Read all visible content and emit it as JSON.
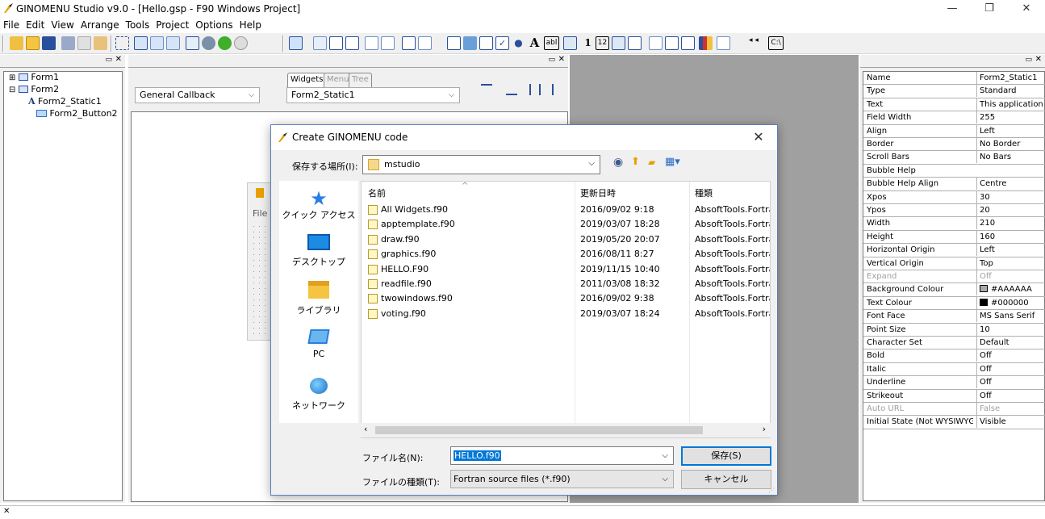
{
  "window": {
    "title": "GINOMENU Studio v9.0 - [Hello.gsp - F90 Windows Project]",
    "minimize": "—",
    "maximize": "❐",
    "close": "✕"
  },
  "menu": [
    "File",
    "Edit",
    "View",
    "Arrange",
    "Tools",
    "Project",
    "Options",
    "Help"
  ],
  "toolbar": {
    "text_tool_glyph": "A",
    "label_tool": "abl",
    "number_tool": "1",
    "int_tool": "12",
    "path_tool": "C:\\"
  },
  "tree": {
    "items": [
      {
        "label": "Form1",
        "expander": "⊞"
      },
      {
        "label": "Form2",
        "expander": "⊟"
      },
      {
        "label": "Form2_Static1",
        "glyph": "A"
      },
      {
        "label": "Form2_Button2"
      }
    ]
  },
  "center": {
    "tabs": [
      "Widgets",
      "Menu",
      "Tree"
    ],
    "callback_combo": "General Callback",
    "widget_combo": "Form2_Static1"
  },
  "form_preview": {
    "menu_label": "File"
  },
  "properties": [
    {
      "name": "Name",
      "value": "Form2_Static1"
    },
    {
      "name": "Type",
      "value": "Standard"
    },
    {
      "name": "Text",
      "value": "This application de"
    },
    {
      "name": "Field Width",
      "value": "255"
    },
    {
      "name": "Align",
      "value": "Left"
    },
    {
      "name": "Border",
      "value": "No Border"
    },
    {
      "name": "Scroll Bars",
      "value": "No Bars"
    },
    {
      "name": "Bubble Help",
      "value": ""
    },
    {
      "name": "Bubble Help Align",
      "value": "Centre"
    },
    {
      "name": "Xpos",
      "value": "30"
    },
    {
      "name": "Ypos",
      "value": "20"
    },
    {
      "name": "Width",
      "value": "210"
    },
    {
      "name": "Height",
      "value": "160"
    },
    {
      "name": "Horizontal Origin",
      "value": "Left"
    },
    {
      "name": "Vertical Origin",
      "value": "Top"
    },
    {
      "name": "Expand",
      "value": "Off",
      "disabled": true
    },
    {
      "name": "Background Colour",
      "value": "#AAAAAA",
      "swatch": "#aaaaaa"
    },
    {
      "name": "Text Colour",
      "value": "#000000",
      "swatch": "#000000"
    },
    {
      "name": "Font Face",
      "value": "MS Sans Serif"
    },
    {
      "name": "Point Size",
      "value": "10"
    },
    {
      "name": "Character Set",
      "value": "Default"
    },
    {
      "name": "Bold",
      "value": "Off"
    },
    {
      "name": "Italic",
      "value": "Off"
    },
    {
      "name": "Underline",
      "value": "Off"
    },
    {
      "name": "Strikeout",
      "value": "Off"
    },
    {
      "name": "Auto URL",
      "value": "False",
      "disabled": true
    },
    {
      "name": "Initial State (Not WYSIWYG)",
      "value": "Visible"
    }
  ],
  "dialog": {
    "title": "Create GINOMENU code",
    "close": "✕",
    "save_in_label": "保存する場所(I):",
    "save_in_value": "mstudio",
    "places": [
      "クイック アクセス",
      "デスクトップ",
      "ライブラリ",
      "PC",
      "ネットワーク"
    ],
    "columns": {
      "name": "名前",
      "date": "更新日時",
      "type": "種類"
    },
    "sort_indicator": "^",
    "files": [
      {
        "name": "All Widgets.f90",
        "date": "2016/09/02 9:18",
        "type": "AbsoftTools.Fortra.."
      },
      {
        "name": "apptemplate.f90",
        "date": "2019/03/07 18:28",
        "type": "AbsoftTools.Fortra.."
      },
      {
        "name": "draw.f90",
        "date": "2019/05/20 20:07",
        "type": "AbsoftTools.Fortra.."
      },
      {
        "name": "graphics.f90",
        "date": "2016/08/11 8:27",
        "type": "AbsoftTools.Fortra.."
      },
      {
        "name": "HELLO.F90",
        "date": "2019/11/15 10:40",
        "type": "AbsoftTools.Fortra.."
      },
      {
        "name": "readfile.f90",
        "date": "2011/03/08 18:32",
        "type": "AbsoftTools.Fortra.."
      },
      {
        "name": "twowindows.f90",
        "date": "2016/09/02 9:38",
        "type": "AbsoftTools.Fortra.."
      },
      {
        "name": "voting.f90",
        "date": "2019/03/07 18:24",
        "type": "AbsoftTools.Fortra.."
      }
    ],
    "filename_label": "ファイル名(N):",
    "filename_value": "HELLO.f90",
    "filetype_label": "ファイルの種類(T):",
    "filetype_value": "Fortran source files (*.f90)",
    "save_button": "保存(S)",
    "cancel_button": "キャンセル"
  },
  "colors": {
    "selection": "#0078d7",
    "gray_workspace": "#a0a0a0",
    "panel": "#f0f0f0"
  }
}
